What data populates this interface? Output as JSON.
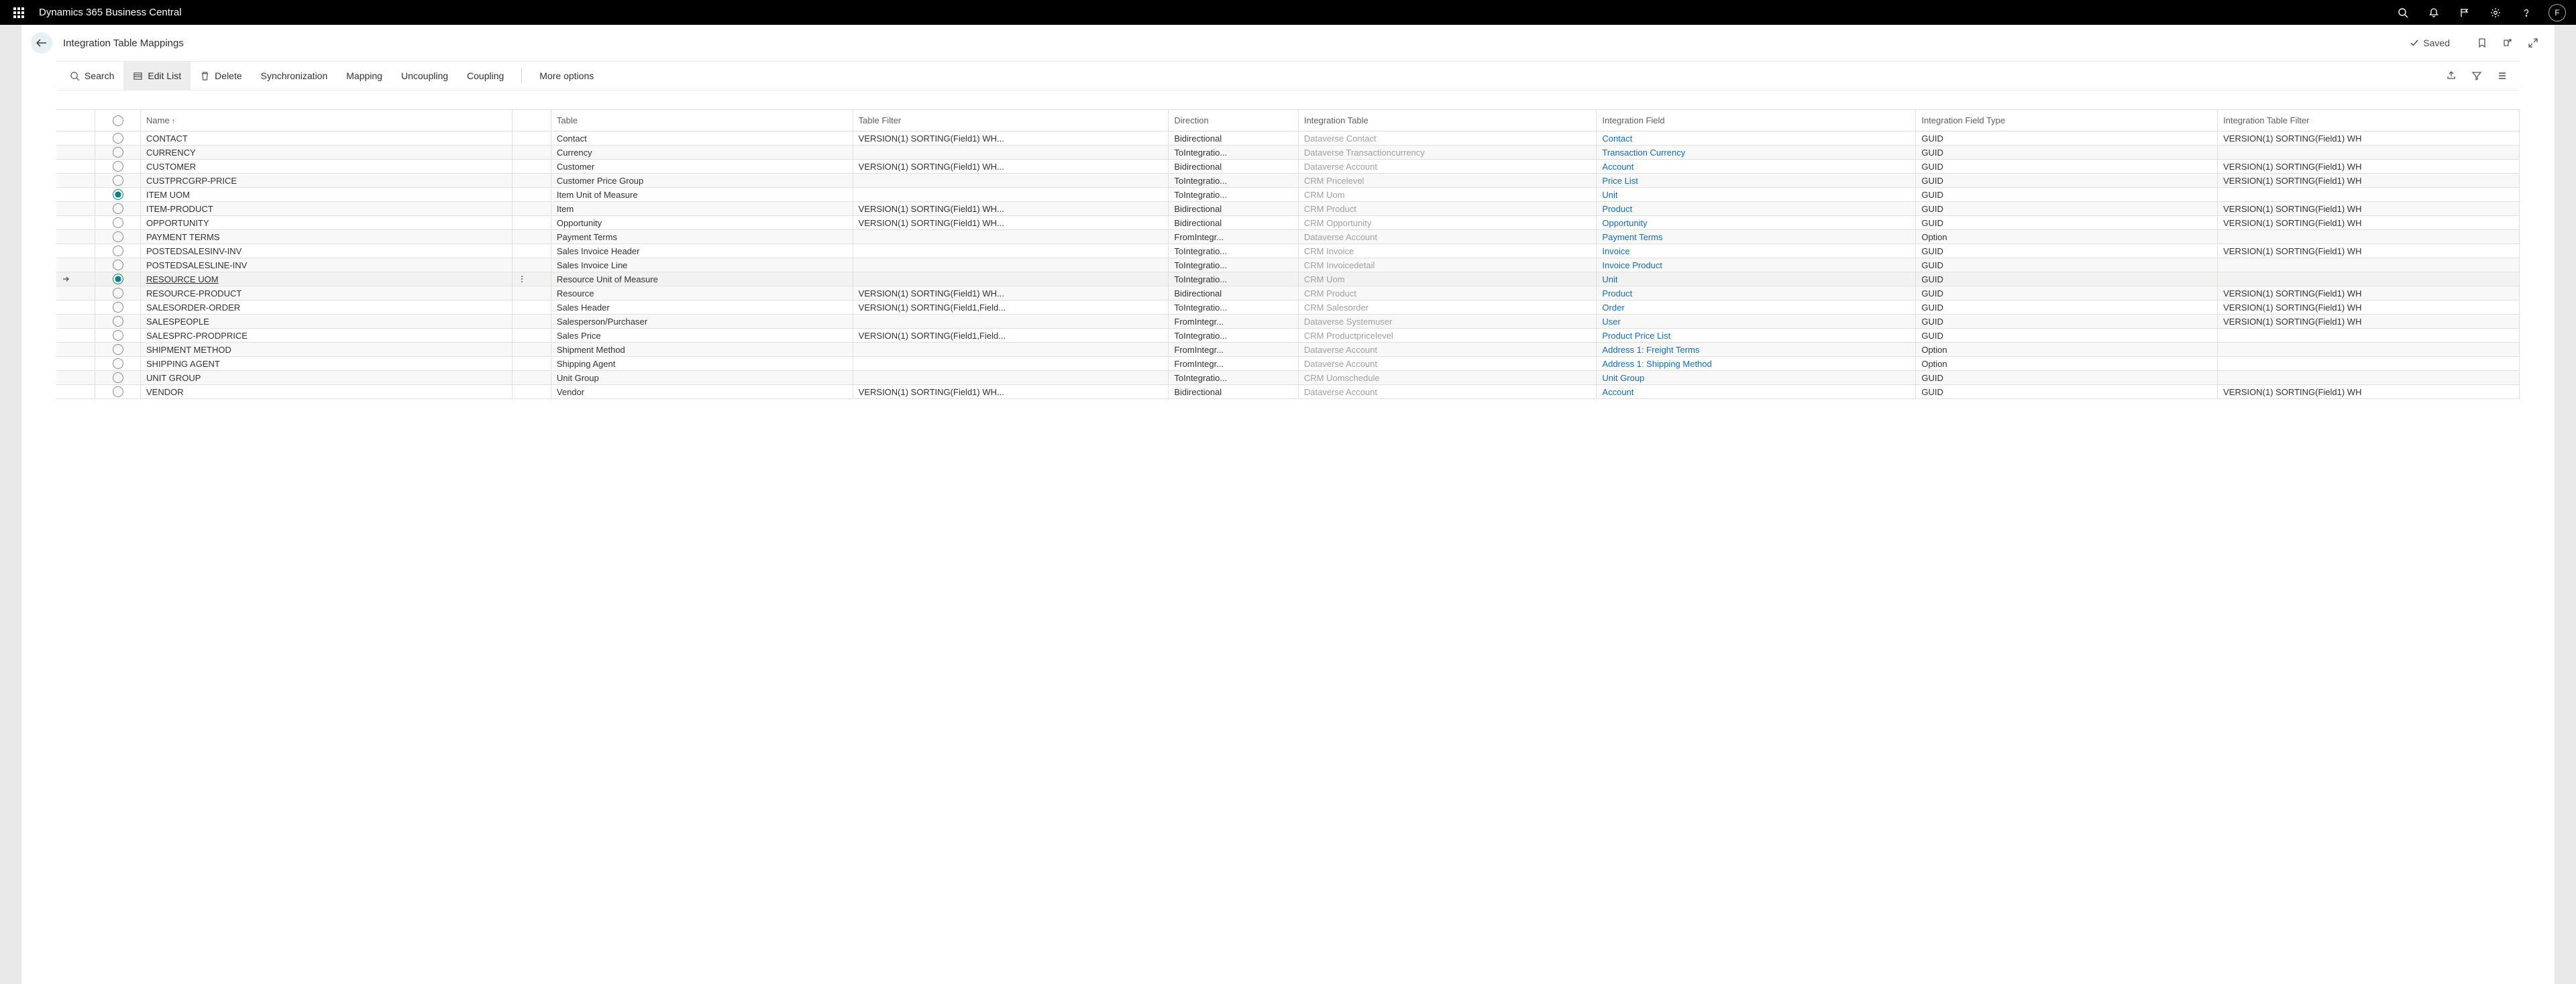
{
  "app": {
    "title": "Dynamics 365 Business Central",
    "user_initial": "F"
  },
  "header": {
    "page_title": "Integration Table Mappings",
    "status": "Saved"
  },
  "actions": {
    "search": "Search",
    "edit_list": "Edit List",
    "delete": "Delete",
    "sync": "Synchronization",
    "mapping": "Mapping",
    "uncoupling": "Uncoupling",
    "coupling": "Coupling",
    "more": "More options"
  },
  "columns": {
    "name": "Name",
    "table": "Table",
    "table_filter": "Table Filter",
    "direction": "Direction",
    "integration_table": "Integration Table",
    "integration_field": "Integration Field",
    "integration_field_type": "Integration Field Type",
    "integration_table_filter": "Integration Table Filter"
  },
  "rows": [
    {
      "checked": false,
      "name": "CONTACT",
      "table": "Contact",
      "tfilter": "VERSION(1) SORTING(Field1) WH...",
      "dir": "Bidirectional",
      "itab": "Dataverse Contact",
      "ifld": "Contact",
      "iftyp": "GUID",
      "itflt": "VERSION(1) SORTING(Field1) WH"
    },
    {
      "checked": false,
      "name": "CURRENCY",
      "table": "Currency",
      "tfilter": "",
      "dir": "ToIntegratio...",
      "itab": "Dataverse Transactioncurrency",
      "ifld": "Transaction Currency",
      "iftyp": "GUID",
      "itflt": ""
    },
    {
      "checked": false,
      "name": "CUSTOMER",
      "table": "Customer",
      "tfilter": "VERSION(1) SORTING(Field1) WH...",
      "dir": "Bidirectional",
      "itab": "Dataverse Account",
      "ifld": "Account",
      "iftyp": "GUID",
      "itflt": "VERSION(1) SORTING(Field1) WH"
    },
    {
      "checked": false,
      "name": "CUSTPRCGRP-PRICE",
      "table": "Customer Price Group",
      "tfilter": "",
      "dir": "ToIntegratio...",
      "itab": "CRM Pricelevel",
      "ifld": "Price List",
      "iftyp": "GUID",
      "itflt": "VERSION(1) SORTING(Field1) WH"
    },
    {
      "checked": true,
      "name": "ITEM UOM",
      "table": "Item Unit of Measure",
      "tfilter": "",
      "dir": "ToIntegratio...",
      "itab": "CRM Uom",
      "ifld": "Unit",
      "iftyp": "GUID",
      "itflt": ""
    },
    {
      "checked": false,
      "name": "ITEM-PRODUCT",
      "table": "Item",
      "tfilter": "VERSION(1) SORTING(Field1) WH...",
      "dir": "Bidirectional",
      "itab": "CRM Product",
      "ifld": "Product",
      "iftyp": "GUID",
      "itflt": "VERSION(1) SORTING(Field1) WH"
    },
    {
      "checked": false,
      "name": "OPPORTUNITY",
      "table": "Opportunity",
      "tfilter": "VERSION(1) SORTING(Field1) WH...",
      "dir": "Bidirectional",
      "itab": "CRM Opportunity",
      "ifld": "Opportunity",
      "iftyp": "GUID",
      "itflt": "VERSION(1) SORTING(Field1) WH"
    },
    {
      "checked": false,
      "name": "PAYMENT TERMS",
      "table": "Payment Terms",
      "tfilter": "",
      "dir": "FromIntegr...",
      "itab": "Dataverse Account",
      "ifld": "Payment Terms",
      "iftyp": "Option",
      "itflt": ""
    },
    {
      "checked": false,
      "name": "POSTEDSALESINV-INV",
      "table": "Sales Invoice Header",
      "tfilter": "",
      "dir": "ToIntegratio...",
      "itab": "CRM Invoice",
      "ifld": "Invoice",
      "iftyp": "GUID",
      "itflt": "VERSION(1) SORTING(Field1) WH"
    },
    {
      "checked": false,
      "name": "POSTEDSALESLINE-INV",
      "table": "Sales Invoice Line",
      "tfilter": "",
      "dir": "ToIntegratio...",
      "itab": "CRM Invoicedetail",
      "ifld": "Invoice Product",
      "iftyp": "GUID",
      "itflt": ""
    },
    {
      "checked": true,
      "name": "RESOURCE UOM",
      "table": "Resource Unit of Measure",
      "tfilter": "",
      "dir": "ToIntegratio...",
      "itab": "CRM Uom",
      "ifld": "Unit",
      "iftyp": "GUID",
      "itflt": "",
      "active": true
    },
    {
      "checked": false,
      "name": "RESOURCE-PRODUCT",
      "table": "Resource",
      "tfilter": "VERSION(1) SORTING(Field1) WH...",
      "dir": "Bidirectional",
      "itab": "CRM Product",
      "ifld": "Product",
      "iftyp": "GUID",
      "itflt": "VERSION(1) SORTING(Field1) WH"
    },
    {
      "checked": false,
      "name": "SALESORDER-ORDER",
      "table": "Sales Header",
      "tfilter": "VERSION(1) SORTING(Field1,Field...",
      "dir": "ToIntegratio...",
      "itab": "CRM Salesorder",
      "ifld": "Order",
      "iftyp": "GUID",
      "itflt": "VERSION(1) SORTING(Field1) WH"
    },
    {
      "checked": false,
      "name": "SALESPEOPLE",
      "table": "Salesperson/Purchaser",
      "tfilter": "",
      "dir": "FromIntegr...",
      "itab": "Dataverse Systemuser",
      "ifld": "User",
      "iftyp": "GUID",
      "itflt": "VERSION(1) SORTING(Field1) WH"
    },
    {
      "checked": false,
      "name": "SALESPRC-PRODPRICE",
      "table": "Sales Price",
      "tfilter": "VERSION(1) SORTING(Field1,Field...",
      "dir": "ToIntegratio...",
      "itab": "CRM Productpricelevel",
      "ifld": "Product Price List",
      "iftyp": "GUID",
      "itflt": ""
    },
    {
      "checked": false,
      "name": "SHIPMENT METHOD",
      "table": "Shipment Method",
      "tfilter": "",
      "dir": "FromIntegr...",
      "itab": "Dataverse Account",
      "ifld": "Address 1: Freight Terms",
      "iftyp": "Option",
      "itflt": ""
    },
    {
      "checked": false,
      "name": "SHIPPING AGENT",
      "table": "Shipping Agent",
      "tfilter": "",
      "dir": "FromIntegr...",
      "itab": "Dataverse Account",
      "ifld": "Address 1: Shipping Method",
      "iftyp": "Option",
      "itflt": ""
    },
    {
      "checked": false,
      "name": "UNIT GROUP",
      "table": "Unit Group",
      "tfilter": "",
      "dir": "ToIntegratio...",
      "itab": "CRM Uomschedule",
      "ifld": "Unit Group",
      "iftyp": "GUID",
      "itflt": ""
    },
    {
      "checked": false,
      "name": "VENDOR",
      "table": "Vendor",
      "tfilter": "VERSION(1) SORTING(Field1) WH...",
      "dir": "Bidirectional",
      "itab": "Dataverse Account",
      "ifld": "Account",
      "iftyp": "GUID",
      "itflt": "VERSION(1) SORTING(Field1) WH"
    }
  ]
}
